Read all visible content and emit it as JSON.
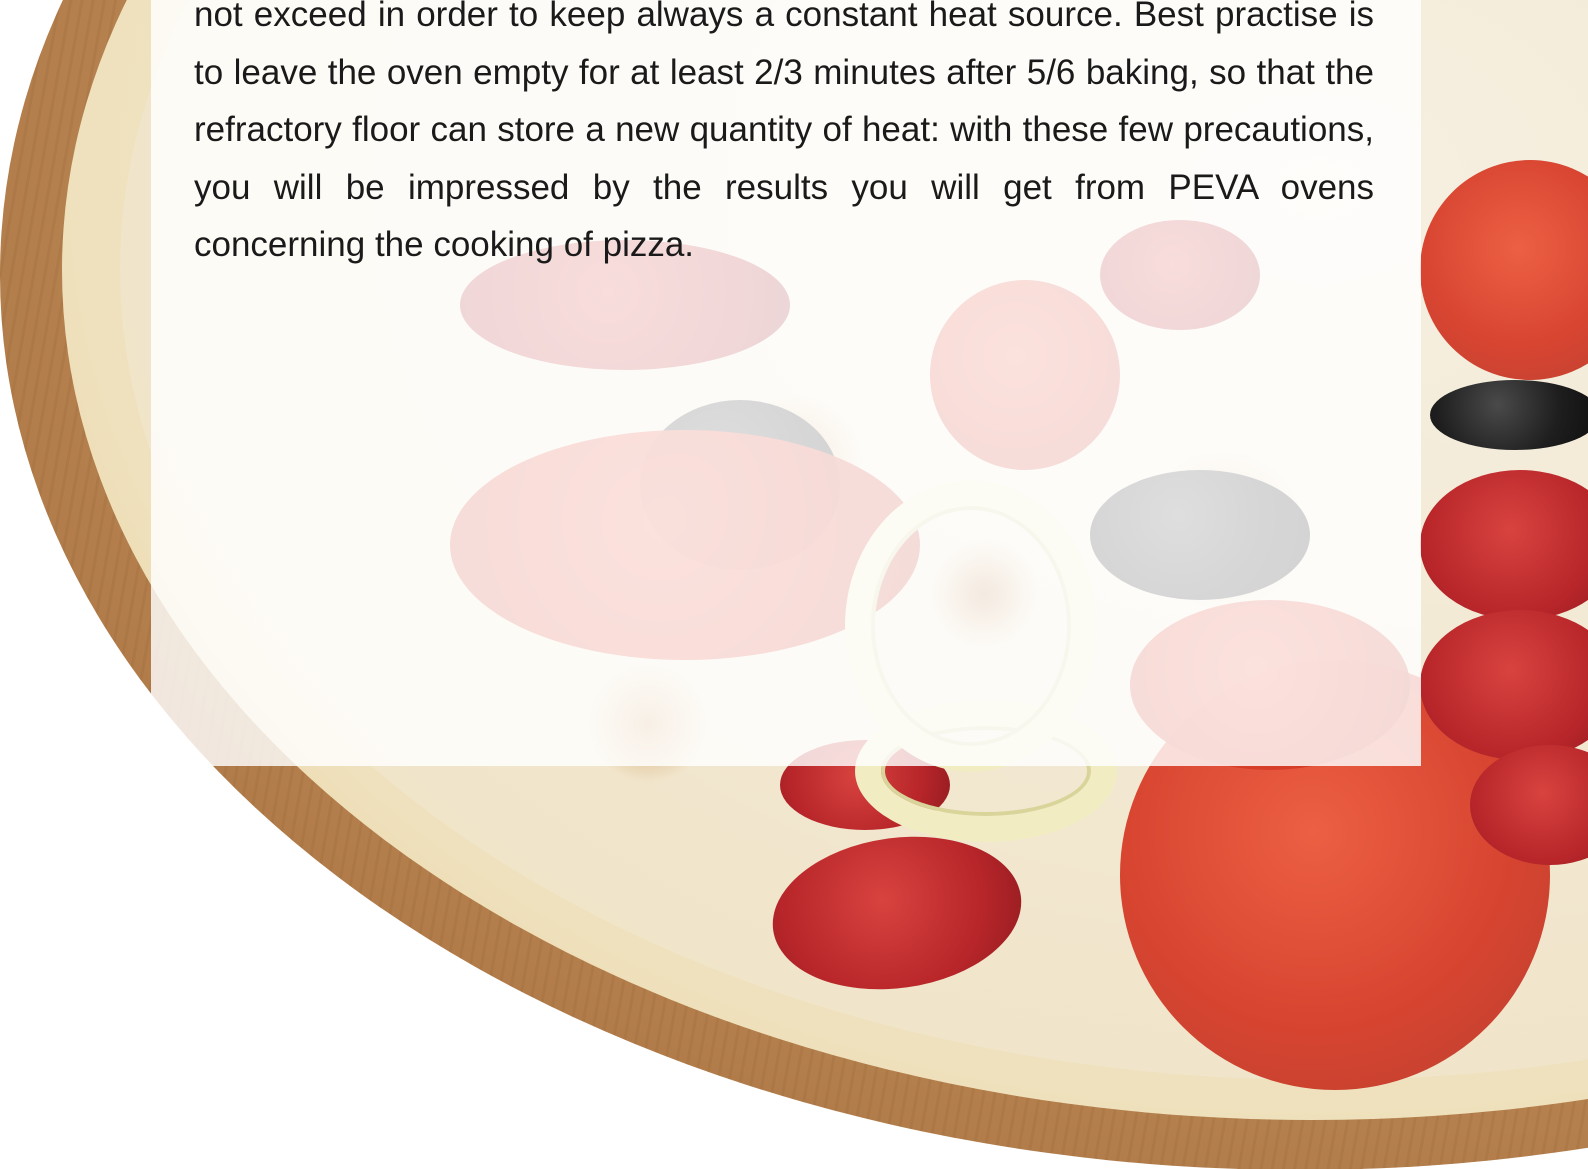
{
  "article": {
    "paragraph": "not exceed in order to keep always a constant heat source. Best practise is to leave the oven empty for at least 2/3 minutes after 5/6 baking, so that the refractory floor can store a new quantity of heat: with these few precautions, you will be impressed by the results you will get from PEVA ovens concerning the cooking of pizza."
  },
  "background": {
    "image": "pizza-photo",
    "colors": {
      "board": "#b98552",
      "crust": "#efe1bd",
      "pepperoni": "#b8262a",
      "tomato": "#d63c28",
      "olive": "#1e1e1e"
    }
  },
  "panel": {
    "background": "#ffffff",
    "text_color": "#1a1a1a"
  }
}
